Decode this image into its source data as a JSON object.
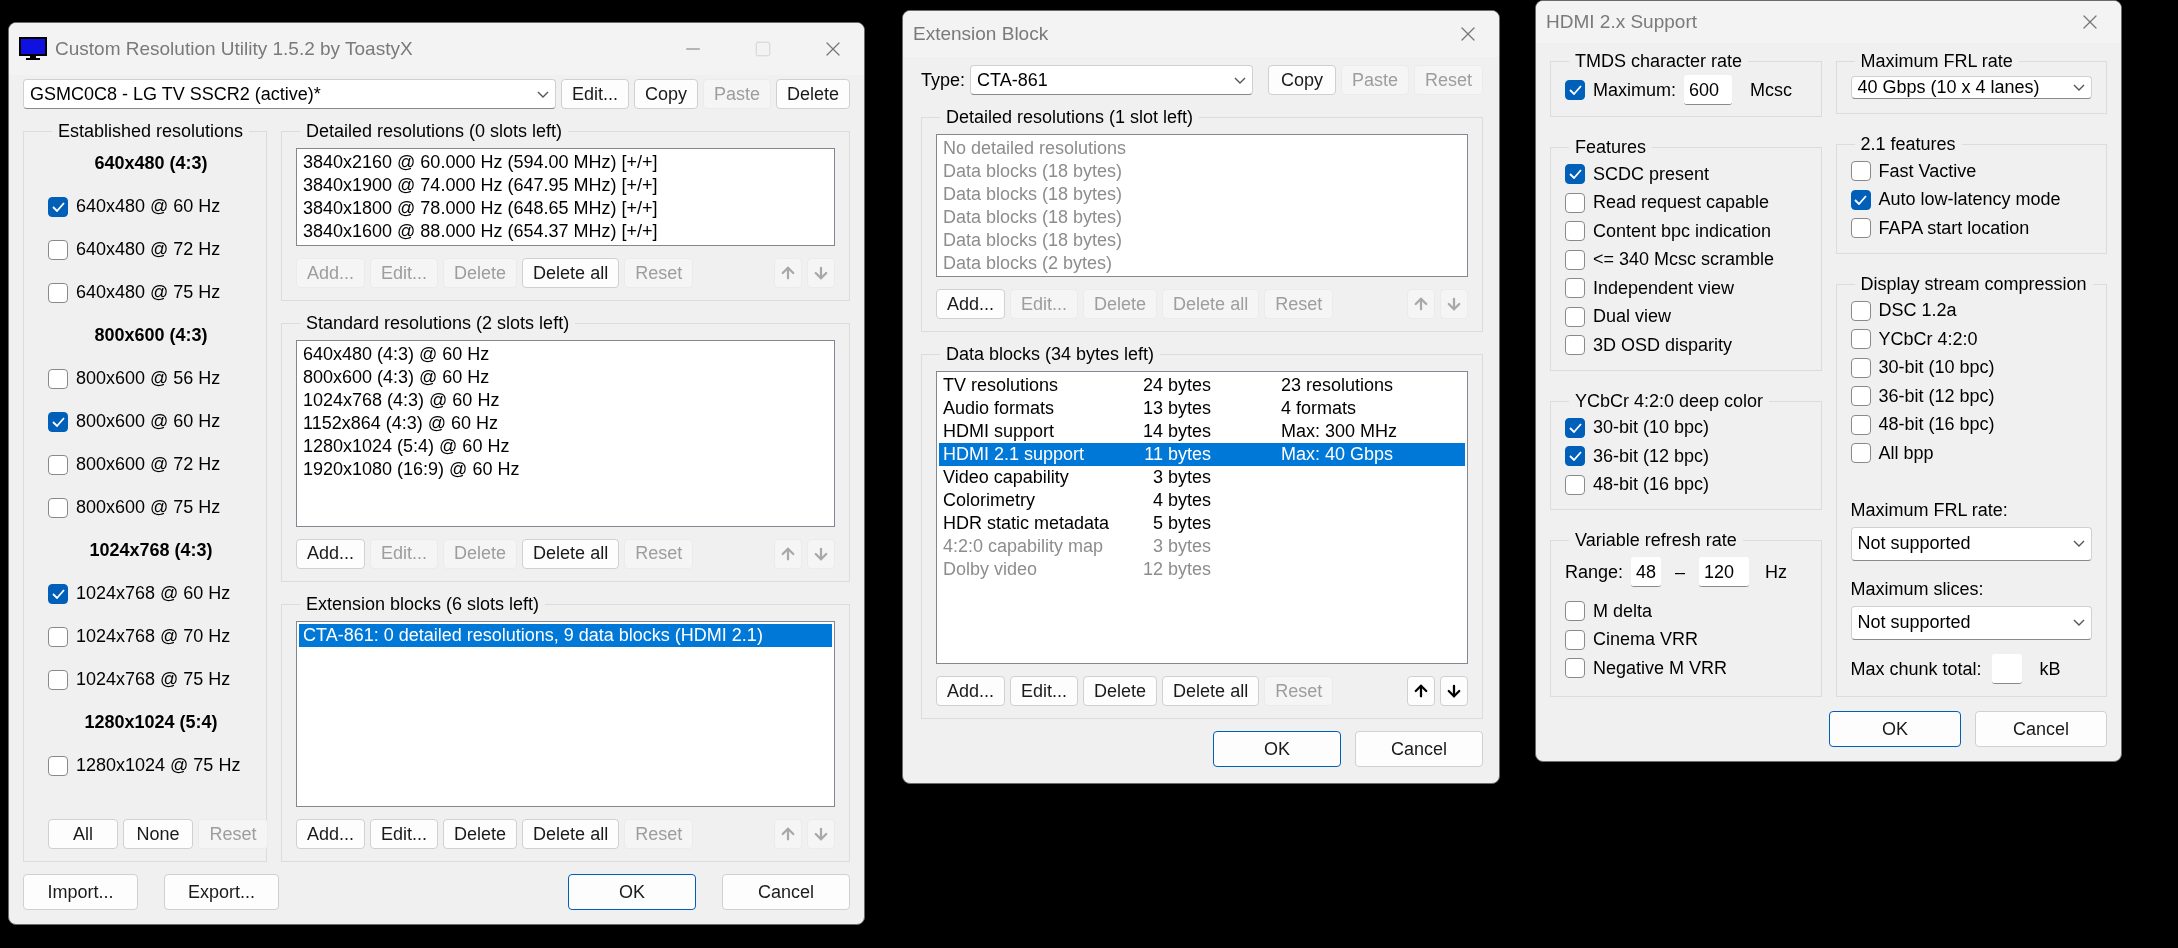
{
  "main_window": {
    "title": "Custom Resolution Utility 1.5.2 by ToastyX",
    "display": "GSMC0C8 - LG TV SSCR2 (active)*",
    "display_buttons": [
      {
        "label": "Edit...",
        "disabled": false
      },
      {
        "label": "Copy",
        "disabled": false
      },
      {
        "label": "Paste",
        "disabled": true
      },
      {
        "label": "Delete",
        "disabled": false
      }
    ],
    "established": {
      "title": "Established resolutions",
      "groups": [
        {
          "heading": "640x480 (4:3)",
          "items": [
            {
              "label": "640x480 @ 60 Hz",
              "checked": true
            },
            {
              "label": "640x480 @ 72 Hz",
              "checked": false
            },
            {
              "label": "640x480 @ 75 Hz",
              "checked": false
            }
          ]
        },
        {
          "heading": "800x600 (4:3)",
          "items": [
            {
              "label": "800x600 @ 56 Hz",
              "checked": false
            },
            {
              "label": "800x600 @ 60 Hz",
              "checked": true
            },
            {
              "label": "800x600 @ 72 Hz",
              "checked": false
            },
            {
              "label": "800x600 @ 75 Hz",
              "checked": false
            }
          ]
        },
        {
          "heading": "1024x768 (4:3)",
          "items": [
            {
              "label": "1024x768 @ 60 Hz",
              "checked": true
            },
            {
              "label": "1024x768 @ 70 Hz",
              "checked": false
            },
            {
              "label": "1024x768 @ 75 Hz",
              "checked": false
            }
          ]
        },
        {
          "heading": "1280x1024 (5:4)",
          "items": [
            {
              "label": "1280x1024 @ 75 Hz",
              "checked": false
            }
          ]
        }
      ],
      "buttons": [
        {
          "label": "All",
          "disabled": false
        },
        {
          "label": "None",
          "disabled": false
        },
        {
          "label": "Reset",
          "disabled": true
        }
      ]
    },
    "sections": [
      {
        "title": "Detailed resolutions (0 slots left)",
        "rows": [
          {
            "text": "3840x2160 @ 60.000 Hz (594.00 MHz) [+/+]",
            "selected": false
          },
          {
            "text": "3840x1900 @ 74.000 Hz (647.95 MHz) [+/+]",
            "selected": false
          },
          {
            "text": "3840x1800 @ 78.000 Hz (648.65 MHz) [+/+]",
            "selected": false
          },
          {
            "text": "3840x1600 @ 88.000 Hz (654.37 MHz) [+/+]",
            "selected": false
          }
        ],
        "buttons": [
          {
            "label": "Add...",
            "disabled": true
          },
          {
            "label": "Edit...",
            "disabled": true
          },
          {
            "label": "Delete",
            "disabled": true
          },
          {
            "label": "Delete all",
            "disabled": false
          },
          {
            "label": "Reset",
            "disabled": true
          }
        ],
        "move_buttons": [
          {
            "kind": "up",
            "disabled": true
          },
          {
            "kind": "down",
            "disabled": true
          }
        ]
      },
      {
        "title": "Standard resolutions (2 slots left)",
        "rows": [
          {
            "text": "640x480 (4:3) @ 60 Hz",
            "selected": false
          },
          {
            "text": "800x600 (4:3) @ 60 Hz",
            "selected": false
          },
          {
            "text": "1024x768 (4:3) @ 60 Hz",
            "selected": false
          },
          {
            "text": "1152x864 (4:3) @ 60 Hz",
            "selected": false
          },
          {
            "text": "1280x1024 (5:4) @ 60 Hz",
            "selected": false
          },
          {
            "text": "1920x1080 (16:9) @ 60 Hz",
            "selected": false
          }
        ],
        "buttons": [
          {
            "label": "Add...",
            "disabled": false
          },
          {
            "label": "Edit...",
            "disabled": true
          },
          {
            "label": "Delete",
            "disabled": true
          },
          {
            "label": "Delete all",
            "disabled": false
          },
          {
            "label": "Reset",
            "disabled": true
          }
        ],
        "move_buttons": [
          {
            "kind": "up",
            "disabled": true
          },
          {
            "kind": "down",
            "disabled": true
          }
        ]
      },
      {
        "title": "Extension blocks (6 slots left)",
        "rows": [
          {
            "text": "CTA-861: 0 detailed resolutions, 9 data blocks (HDMI 2.1)",
            "selected": true
          }
        ],
        "buttons": [
          {
            "label": "Add...",
            "disabled": false
          },
          {
            "label": "Edit...",
            "disabled": false
          },
          {
            "label": "Delete",
            "disabled": false
          },
          {
            "label": "Delete all",
            "disabled": false
          },
          {
            "label": "Reset",
            "disabled": true
          }
        ],
        "move_buttons": [
          {
            "kind": "up",
            "disabled": true
          },
          {
            "kind": "down",
            "disabled": true
          }
        ]
      }
    ],
    "footer_buttons": [
      {
        "label": "Import...",
        "default": false
      },
      {
        "label": "Export...",
        "default": false
      },
      {
        "label": "OK",
        "default": true
      },
      {
        "label": "Cancel",
        "default": false
      }
    ]
  },
  "extension_dialog": {
    "title": "Extension Block",
    "type_label": "Type:",
    "type_value": "CTA-861",
    "type_buttons": [
      {
        "label": "Copy",
        "disabled": false
      },
      {
        "label": "Paste",
        "disabled": true
      },
      {
        "label": "Reset",
        "disabled": true
      }
    ],
    "detailed": {
      "title": "Detailed resolutions (1 slot left)",
      "rows": [
        {
          "text": "No detailed resolutions",
          "disabled": true
        },
        {
          "text": "Data blocks (18 bytes)",
          "disabled": true
        },
        {
          "text": "Data blocks (18 bytes)",
          "disabled": true
        },
        {
          "text": "Data blocks (18 bytes)",
          "disabled": true
        },
        {
          "text": "Data blocks (18 bytes)",
          "disabled": true
        },
        {
          "text": "Data blocks (2 bytes)",
          "disabled": true
        }
      ],
      "buttons": [
        {
          "label": "Add...",
          "disabled": false
        },
        {
          "label": "Edit...",
          "disabled": true
        },
        {
          "label": "Delete",
          "disabled": true
        },
        {
          "label": "Delete all",
          "disabled": true
        },
        {
          "label": "Reset",
          "disabled": true
        }
      ],
      "move_buttons": [
        {
          "kind": "up",
          "disabled": true
        },
        {
          "kind": "down",
          "disabled": true
        }
      ]
    },
    "data_blocks": {
      "title": "Data blocks (34 bytes left)",
      "rows": [
        {
          "name": "TV resolutions",
          "size": "24 bytes",
          "info": "23 resolutions",
          "selected": false,
          "disabled": false
        },
        {
          "name": "Audio formats",
          "size": "13 bytes",
          "info": "4 formats",
          "selected": false,
          "disabled": false
        },
        {
          "name": "HDMI support",
          "size": "14 bytes",
          "info": "Max: 300 MHz",
          "selected": false,
          "disabled": false
        },
        {
          "name": "HDMI 2.1 support",
          "size": "11 bytes",
          "info": "Max: 40 Gbps",
          "selected": true,
          "disabled": false
        },
        {
          "name": "Video capability",
          "size": "3 bytes",
          "selected": false,
          "disabled": false
        },
        {
          "name": "Colorimetry",
          "size": "4 bytes",
          "selected": false,
          "disabled": false
        },
        {
          "name": "HDR static metadata",
          "size": "5 bytes",
          "selected": false,
          "disabled": false
        },
        {
          "name": "4:2:0 capability map",
          "size": "3 bytes",
          "selected": false,
          "disabled": true
        },
        {
          "name": "Dolby video",
          "size": "12 bytes",
          "selected": false,
          "disabled": true
        }
      ],
      "buttons": [
        {
          "label": "Add...",
          "disabled": false
        },
        {
          "label": "Edit...",
          "disabled": false
        },
        {
          "label": "Delete",
          "disabled": false
        },
        {
          "label": "Delete all",
          "disabled": false
        },
        {
          "label": "Reset",
          "disabled": true
        }
      ],
      "move_buttons": [
        {
          "kind": "up",
          "disabled": false
        },
        {
          "kind": "down",
          "disabled": false
        }
      ]
    },
    "buttons": [
      {
        "label": "OK",
        "default": true
      },
      {
        "label": "Cancel",
        "default": false
      }
    ]
  },
  "hdmi_dialog": {
    "title": "HDMI 2.x Support",
    "tmds": {
      "title": "TMDS character rate",
      "checkbox": {
        "label": "Maximum:",
        "checked": true
      },
      "value": "600",
      "unit": "Mcsc"
    },
    "features": {
      "title": "Features",
      "items": [
        {
          "label": "SCDC present",
          "checked": true
        },
        {
          "label": "Read request capable",
          "checked": false
        },
        {
          "label": "Content bpc indication",
          "checked": false
        },
        {
          "label": "<= 340 Mcsc scramble",
          "checked": false
        },
        {
          "label": "Independent view",
          "checked": false
        },
        {
          "label": "Dual view",
          "checked": false
        },
        {
          "label": "3D OSD disparity",
          "checked": false
        }
      ]
    },
    "deep_color": {
      "title": "YCbCr 4:2:0 deep color",
      "items": [
        {
          "label": "30-bit (10 bpc)",
          "checked": true
        },
        {
          "label": "36-bit (12 bpc)",
          "checked": true
        },
        {
          "label": "48-bit (16 bpc)",
          "checked": false
        }
      ]
    },
    "vrr": {
      "title": "Variable refresh rate",
      "range_label": "Range:",
      "min": "48",
      "separator": "–",
      "max": "120",
      "unit": "Hz",
      "items": [
        {
          "label": "M delta",
          "checked": false
        },
        {
          "label": "Cinema VRR",
          "checked": false
        },
        {
          "label": "Negative M VRR",
          "checked": false
        }
      ]
    },
    "frl": {
      "title": "Maximum FRL rate",
      "value": "40 Gbps (10 x 4 lanes)"
    },
    "features_21": {
      "title": "2.1 features",
      "items": [
        {
          "label": "Fast Vactive",
          "checked": false
        },
        {
          "label": "Auto low-latency mode",
          "checked": true
        },
        {
          "label": "FAPA start location",
          "checked": false
        }
      ]
    },
    "dsc": {
      "title": "Display stream compression",
      "items": [
        {
          "label": "DSC 1.2a",
          "checked": false
        },
        {
          "label": "YCbCr 4:2:0",
          "checked": false
        },
        {
          "label": "30-bit (10 bpc)",
          "checked": false
        },
        {
          "label": "36-bit (12 bpc)",
          "checked": false
        },
        {
          "label": "48-bit (16 bpc)",
          "checked": false
        },
        {
          "label": "All bpp",
          "checked": false
        }
      ],
      "frl_label": "Maximum FRL rate:",
      "frl_value": "Not supported",
      "slices_label": "Maximum slices:",
      "slices_value": "Not supported",
      "chunk_label": "Max chunk total:",
      "chunk_unit": "kB"
    },
    "buttons": [
      {
        "label": "OK",
        "default": true
      },
      {
        "label": "Cancel",
        "default": false
      }
    ]
  }
}
